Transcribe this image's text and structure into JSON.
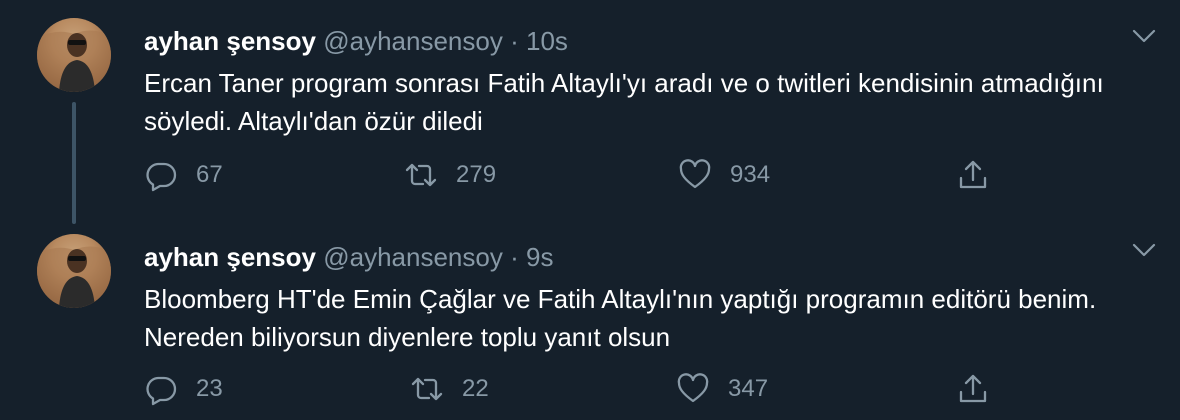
{
  "tweets": [
    {
      "name": "ayhan şensoy",
      "handle": "@ayhansensoy",
      "separator": "·",
      "time": "10s",
      "text": "Ercan Taner program sonrası Fatih Altaylı'yı aradı ve o twitleri kendisinin atmadığını söyledi. Altaylı'dan özür diledi",
      "replies": "67",
      "retweets": "279",
      "likes": "934"
    },
    {
      "name": "ayhan şensoy",
      "handle": "@ayhansensoy",
      "separator": "·",
      "time": "9s",
      "text": "Bloomberg HT'de Emin Çağlar ve Fatih Altaylı'nın yaptığı programın editörü benim. Nereden biliyorsun diyenlere toplu yanıt olsun",
      "replies": "23",
      "retweets": "22",
      "likes": "347"
    }
  ],
  "colors": {
    "background": "#15202b",
    "text": "#ffffff",
    "secondary": "#8899a6",
    "thread_line": "#3d5466"
  },
  "icons": [
    "reply-icon",
    "retweet-icon",
    "like-icon",
    "share-icon",
    "chevron-down-icon"
  ]
}
